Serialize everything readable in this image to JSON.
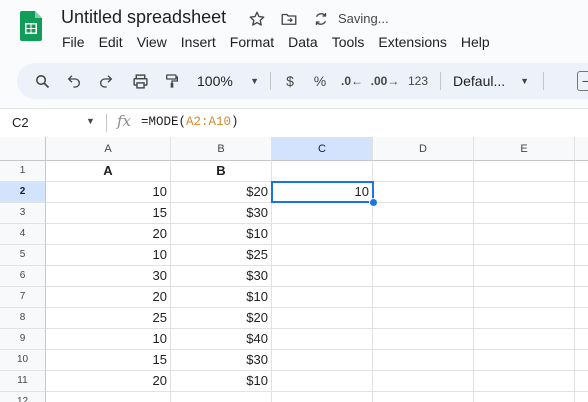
{
  "app": {
    "title": "Untitled spreadsheet",
    "status": "Saving...",
    "brand_color": "#0f9d58"
  },
  "menu": [
    "File",
    "Edit",
    "View",
    "Insert",
    "Format",
    "Data",
    "Tools",
    "Extensions",
    "Help"
  ],
  "toolbar": {
    "zoom": "100%",
    "currency_label": "$",
    "percent_label": "%",
    "decrease_decimal_label": ".0←",
    "increase_decimal_label": ".00→",
    "more_formats_label": "123",
    "font_label": "Defaul...",
    "font_size_minus_label": "−"
  },
  "formula_bar": {
    "cell_ref": "C2",
    "fx": "fx",
    "formula_prefix": "=MODE(",
    "formula_range": "A2:A10",
    "formula_suffix": ")"
  },
  "sheet": {
    "columns": [
      "A",
      "B",
      "C",
      "D",
      "E"
    ],
    "selected_column": "C",
    "selected_row": 2,
    "rows": [
      {
        "num": "1",
        "a": "A",
        "b": "B",
        "c": ""
      },
      {
        "num": "2",
        "a": "10",
        "b": "$20",
        "c": "10"
      },
      {
        "num": "3",
        "a": "15",
        "b": "$30",
        "c": ""
      },
      {
        "num": "4",
        "a": "20",
        "b": "$10",
        "c": ""
      },
      {
        "num": "5",
        "a": "10",
        "b": "$25",
        "c": ""
      },
      {
        "num": "6",
        "a": "30",
        "b": "$30",
        "c": ""
      },
      {
        "num": "7",
        "a": "20",
        "b": "$10",
        "c": ""
      },
      {
        "num": "8",
        "a": "25",
        "b": "$20",
        "c": ""
      },
      {
        "num": "9",
        "a": "10",
        "b": "$40",
        "c": ""
      },
      {
        "num": "10",
        "a": "15",
        "b": "$30",
        "c": ""
      },
      {
        "num": "11",
        "a": "20",
        "b": "$10",
        "c": ""
      },
      {
        "num": "12",
        "a": "",
        "b": "",
        "c": ""
      }
    ]
  }
}
